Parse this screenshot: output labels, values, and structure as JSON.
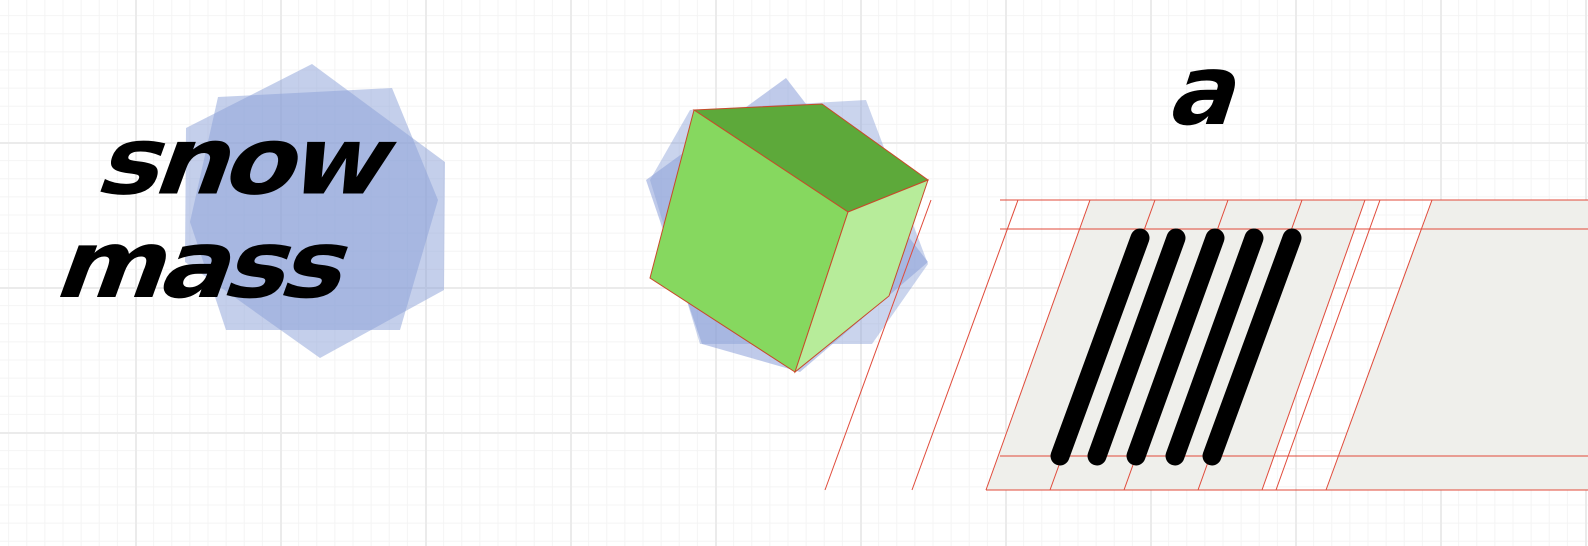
{
  "logo": {
    "line1": "snow",
    "line2": "mass"
  },
  "glyph_specimen": {
    "letter": "a"
  },
  "colors": {
    "background": "#ffffff",
    "grid_major": "#ebebeb",
    "grid_minor": "#f4f4f4",
    "star_blue": "#8a9fd8",
    "cube_top": "#5da93a",
    "cube_left": "#86d85f",
    "cube_right": "#b7ec9a",
    "guide_red": "#e04a3a",
    "guide_band": "#efefeb",
    "ink": "#000000"
  },
  "icons": {
    "logo_star": "hexagram-star",
    "cube": "isometric-cube",
    "stripes": "slanted-bars"
  },
  "stripes": {
    "count": 5
  }
}
